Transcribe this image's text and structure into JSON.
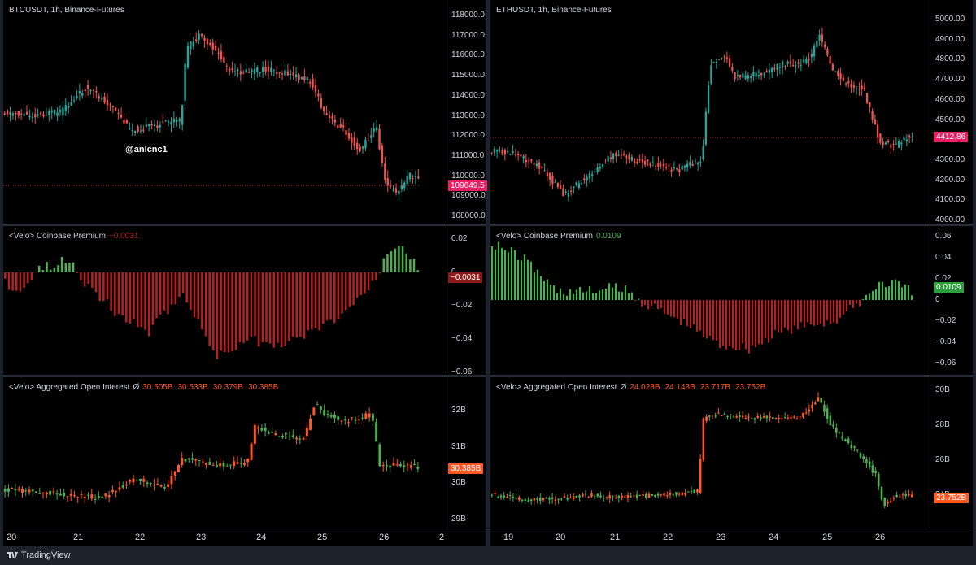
{
  "footer": {
    "brand": "TradingView",
    "logo_icon": "tradingview-logo-icon"
  },
  "charts": [
    {
      "symbol": "BTCUSDT, 1h, Binance-Futures",
      "price_ticks": [
        "118000.0",
        "117000.0",
        "116000.0",
        "115000.0",
        "114000.0",
        "113000.0",
        "112000.0",
        "111000.0",
        "110000.0",
        "109000.0",
        "108000.0"
      ],
      "price_tag": "109649.5",
      "watermark": "@anlcnc1",
      "premium": {
        "title": "<Velo> Coinbase Premium",
        "value": "−0.0031",
        "ticks": [
          "0.02",
          "0",
          "−0.02",
          "−0.04",
          "−0.06"
        ],
        "tag": "−0.0031"
      },
      "oi": {
        "title": "<Velo> Aggregated Open Interest",
        "symbol": "Ø",
        "values": [
          "30.505B",
          "30.533B",
          "30.379B",
          "30.385B"
        ],
        "ticks": [
          "32B",
          "31B",
          "30B",
          "29B"
        ],
        "tag": "30.385B"
      },
      "time_labels": [
        "20",
        "21",
        "22",
        "23",
        "24",
        "25",
        "26",
        "2"
      ]
    },
    {
      "symbol": "ETHUSDT, 1h, Binance-Futures",
      "price_ticks": [
        "5000.00",
        "4900.00",
        "4800.00",
        "4700.00",
        "4600.00",
        "4500.00",
        "4400.00",
        "4300.00",
        "4200.00",
        "4100.00",
        "4000.00"
      ],
      "price_tag": "4412.86",
      "premium": {
        "title": "<Velo> Coinbase Premium",
        "value": "0.0109",
        "ticks": [
          "0.06",
          "0.04",
          "0.02",
          "0",
          "−0.02",
          "−0.04",
          "−0.06"
        ],
        "tag": "0.0109"
      },
      "oi": {
        "title": "<Velo> Aggregated Open Interest",
        "symbol": "Ø",
        "values": [
          "24.028B",
          "24.143B",
          "23.717B",
          "23.752B"
        ],
        "ticks": [
          "30B",
          "28B",
          "26B",
          "24B"
        ],
        "tag": "23.752B"
      },
      "time_labels": [
        "19",
        "20",
        "21",
        "22",
        "23",
        "24",
        "25",
        "26"
      ]
    }
  ],
  "colors": {
    "up": "#26a69a",
    "down": "#ef5350",
    "tag_down": "#e91e63",
    "oi_up": "#4caf50",
    "oi_down": "#ff5722",
    "prem_pos": "#4caf50",
    "prem_neg": "#b22222"
  }
}
